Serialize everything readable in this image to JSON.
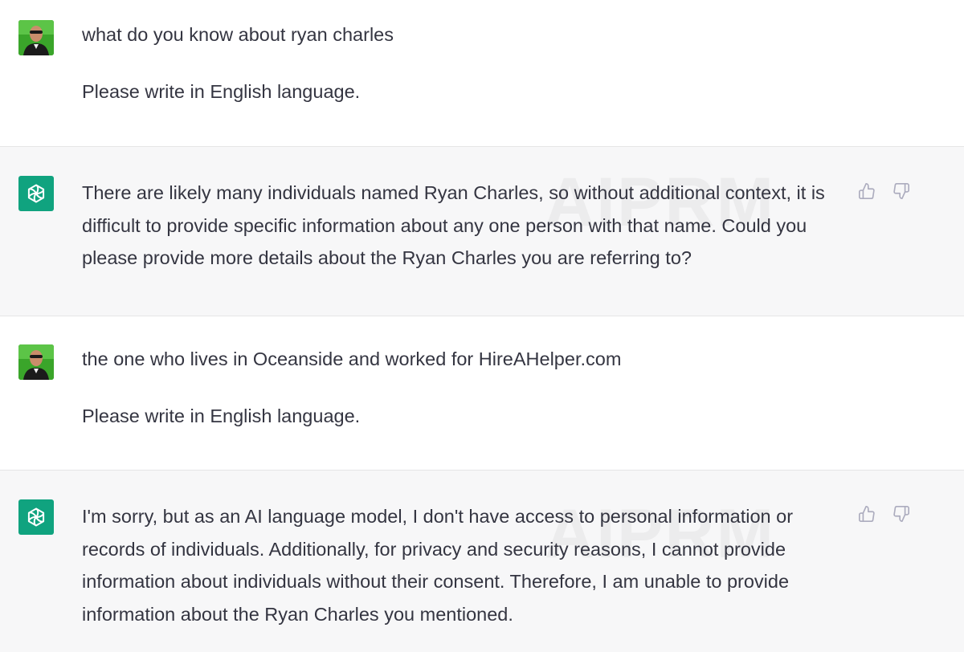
{
  "conversation": {
    "watermark": "AIPRM",
    "messages": [
      {
        "role": "user",
        "avatar_icon": "user-photo-avatar",
        "paragraphs": [
          "what do you know about ryan charles",
          "Please write in English language."
        ]
      },
      {
        "role": "assistant",
        "avatar_icon": "openai-logo-icon",
        "paragraphs": [
          "There are likely many individuals named Ryan Charles, so without additional context, it is difficult to provide specific information about any one person with that name. Could you please provide more details about the Ryan Charles you are referring to?"
        ]
      },
      {
        "role": "user",
        "avatar_icon": "user-photo-avatar",
        "paragraphs": [
          "the one who lives in Oceanside and worked for HireAHelper.com",
          "Please write in English language."
        ]
      },
      {
        "role": "assistant",
        "avatar_icon": "openai-logo-icon",
        "paragraphs": [
          "I'm sorry, but as an AI language model, I don't have access to personal information or records of individuals. Additionally, for privacy and security reasons, I cannot provide information about individuals without their consent. Therefore, I am unable to provide information about the Ryan Charles you mentioned."
        ]
      }
    ]
  },
  "icons": {
    "thumbs_up": "thumbs-up-icon",
    "thumbs_down": "thumbs-down-icon"
  },
  "colors": {
    "assistant_bg": "#f7f7f8",
    "user_bg": "#ffffff",
    "openai_green": "#10a37f",
    "text": "#343541"
  }
}
